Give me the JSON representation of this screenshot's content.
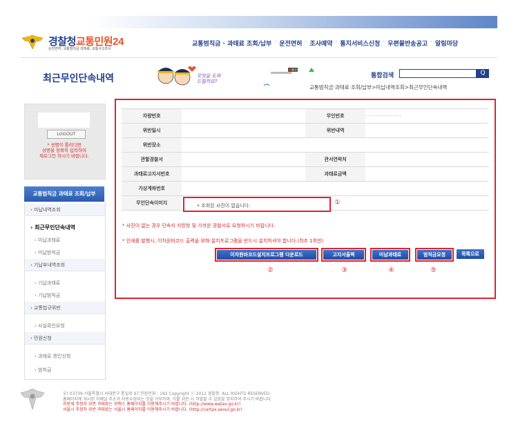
{
  "header": {
    "logo_title_part1": "경찰청",
    "logo_title_part2": "교통민원24",
    "logo_sub": "운전면허, 교통범칙금·과태료, 교통사고조사",
    "nav": [
      "교통범칙금 · 과태료 조회/납부",
      "운전면허",
      "조사예약",
      "통지서비스신청",
      "우편물반송공고",
      "알림마당"
    ]
  },
  "page": {
    "title": "최근무인단속내역",
    "illustration_text": "무엇을 도와드릴까요?",
    "search_label": "통합검색",
    "search_value": "",
    "search_button": "Q",
    "breadcrumb": "교통범칙금·과태료 조회/납부>미납내역조회>최근무인단속내역"
  },
  "login": {
    "logout": "LOGOUT",
    "message_lines": [
      "* 성명이 틀리다면",
      "성명을 정확히 입력하여",
      "재로그인 하시기 바랍니다."
    ]
  },
  "sidebar": {
    "heading": "교통범칙금 과태료 조회/납부",
    "items": [
      {
        "label": "› 미납내역조회",
        "kind": "cat"
      },
      {
        "label": "› 최근무인단속내역",
        "kind": "active"
      },
      {
        "label": "› 미납과태료",
        "kind": "sub"
      },
      {
        "label": "› 미납범칙금",
        "kind": "sub"
      },
      {
        "label": "› 기납부내역조회",
        "kind": "cat"
      },
      {
        "label": "› 기납과태료",
        "kind": "sub"
      },
      {
        "label": "› 기납범칙금",
        "kind": "sub"
      },
      {
        "label": "› 교통법규위반",
        "kind": "cat"
      },
      {
        "label": "› 사실확인요청",
        "kind": "sub"
      },
      {
        "label": "› 민원신청",
        "kind": "cat"
      },
      {
        "label": "› 과태료 렌인신청",
        "kind": "sub"
      },
      {
        "label": "› 범칙금",
        "kind": "sub"
      }
    ]
  },
  "detail": {
    "rows": [
      {
        "l1": "차량번호",
        "v1": "",
        "l2": "무인번호",
        "v2": "---------------"
      },
      {
        "l1": "위반일시",
        "v1": "",
        "l2": "위반내역",
        "v2": ""
      },
      {
        "l1": "위반장소",
        "v1": "",
        "l2": "",
        "v2": ""
      },
      {
        "l1": "관할경찰서",
        "v1": "",
        "l2": "관서연락처",
        "v2": ""
      },
      {
        "l1": "과태료고지서번호",
        "v1": "",
        "l2": "과태료금액",
        "v2": ""
      },
      {
        "l1": "가상계좌번호",
        "v1": "",
        "l2": "",
        "v2": ""
      },
      {
        "l1": "무인단속이미지",
        "v1": "",
        "l2": "",
        "v2": ""
      }
    ],
    "image_message": "• 조회된 사진이 없습니다.",
    "notice1": "* 사진이 없는 경우 단속지 지방청 및 가까운 경찰서로 요청하시기 바랍니다.",
    "notice2": "* 인쇄를 발행시, 이차원바코드 출력을 위해 설치프로그램을 반드시 설치하셔야 합니다.(최초 1회만)",
    "markers": [
      "①",
      "②",
      "③",
      "④",
      "⑤"
    ]
  },
  "buttons": {
    "download": "이차원바코드설치프로그램 다운로드",
    "print": "고지서출력",
    "unpaid": "미납과태료",
    "fine_request": "범칙금요청",
    "list": "목록으로"
  },
  "footer": {
    "line1": "우) 03739 서울특별시 서대문구 통일로 97 민원전화 : 182    Copyright ⓒ 2012 경찰청. ALL RIGHTS RESERVED",
    "line2": "홈페이지에 게시된 이메일 주소가 자동수집되는 것을 거부하며, 이를 위반 시 처벌될 수 있음을 양지하여 주시기 바랍니다.",
    "line3": "지방세 주정차 위반 과태료는 위택스 홈페이지를 이용해주시기 바랍니다. (http://www.wetax.go.kr)",
    "line4": "서울시 주정차 위반 과태료는 서울시 홈페이지를 이용해주시기 바랍니다. (http://cartax.seoul.go.kr)"
  },
  "colors": {
    "brand": "#23408e",
    "accent": "#e0202e",
    "button": "#2a5bb0"
  }
}
